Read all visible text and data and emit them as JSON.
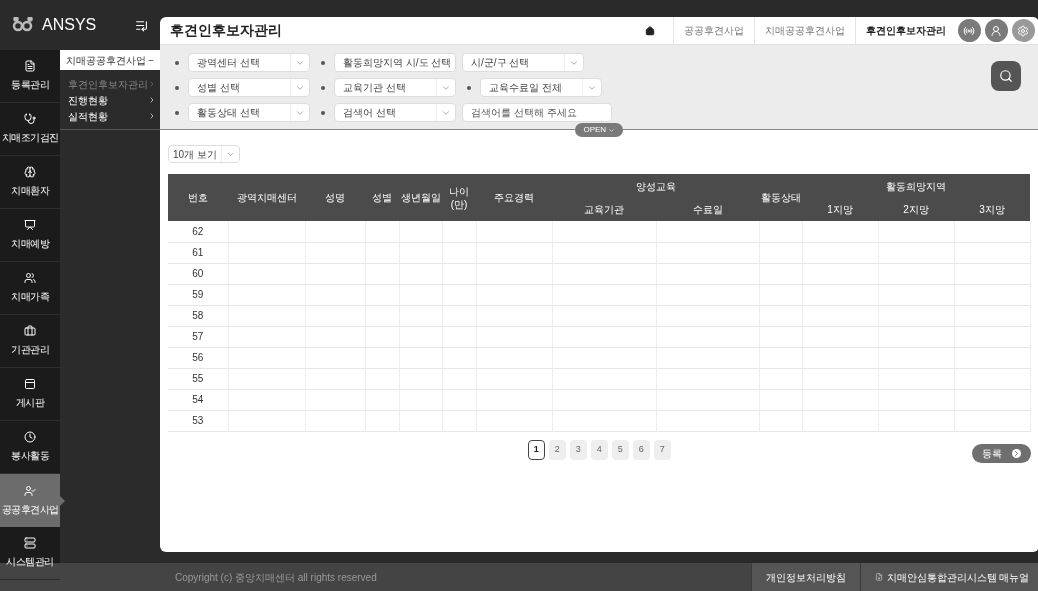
{
  "app": {
    "logo": "ANSYS"
  },
  "rail": [
    {
      "label": "등록관리",
      "selected": false
    },
    {
      "label": "치매조기검진",
      "selected": false
    },
    {
      "label": "치매환자",
      "selected": false
    },
    {
      "label": "치매예방",
      "selected": false
    },
    {
      "label": "치매가족",
      "selected": false
    },
    {
      "label": "기관관리",
      "selected": false
    },
    {
      "label": "게시판",
      "selected": false
    },
    {
      "label": "봉사활동",
      "selected": false
    },
    {
      "label": "공공후견사업",
      "selected": true
    },
    {
      "label": "시스템관리",
      "selected": false
    }
  ],
  "submenu": {
    "title": "치매공공후견사업",
    "toggle": "−",
    "items": [
      {
        "label": "후견인후보자관리",
        "selected": true
      },
      {
        "label": "진행현황",
        "selected": false
      },
      {
        "label": "실적현황",
        "selected": false
      }
    ]
  },
  "page": {
    "title": "후견인후보자관리",
    "breadcrumb": [
      {
        "label": "공공후견사업",
        "selected": false
      },
      {
        "label": "치매공공후견사업",
        "selected": false
      },
      {
        "label": "후견인후보자관리",
        "selected": true
      }
    ]
  },
  "filters": [
    [
      {
        "kind": "select",
        "label": "광역센터 선택",
        "bullet": true
      },
      {
        "kind": "select",
        "label": "활동희망지역 시/도 선택",
        "bullet": true
      },
      {
        "kind": "select",
        "label": "시/군/구 선택",
        "bullet": false
      }
    ],
    [
      {
        "kind": "select",
        "label": "성별 선택",
        "bullet": true
      },
      {
        "kind": "select",
        "label": "교육기관 선택",
        "bullet": true
      },
      {
        "kind": "select",
        "label": "교육수료일 전체",
        "bullet": true
      }
    ],
    [
      {
        "kind": "select",
        "label": "활동상태 선택",
        "bullet": true
      },
      {
        "kind": "select",
        "label": "검색어 선택",
        "bullet": true
      },
      {
        "kind": "input",
        "placeholder": "검색어를 선택해 주세요"
      }
    ]
  ],
  "filter_toggle": "OPEN",
  "page_size": "10개 보기",
  "table": {
    "columns": [
      {
        "label": "번호"
      },
      {
        "label": "광역치매센터"
      },
      {
        "label": "성명"
      },
      {
        "label": "성별"
      },
      {
        "label": "생년월일"
      },
      {
        "label": "나이\n(만)"
      },
      {
        "label": "주요경력"
      },
      {
        "label": "양성교육",
        "children": [
          {
            "label": "교육기관"
          },
          {
            "label": "수료일"
          }
        ]
      },
      {
        "label": "활동상태"
      },
      {
        "label": "활동희망지역",
        "children": [
          {
            "label": "1지망"
          },
          {
            "label": "2지망"
          },
          {
            "label": "3지망"
          }
        ]
      }
    ],
    "rows": [
      {
        "number": "62"
      },
      {
        "number": "61"
      },
      {
        "number": "60"
      },
      {
        "number": "59"
      },
      {
        "number": "58"
      },
      {
        "number": "57"
      },
      {
        "number": "56"
      },
      {
        "number": "55"
      },
      {
        "number": "54"
      },
      {
        "number": "53"
      }
    ]
  },
  "pagination": [
    {
      "label": "1",
      "selected": true
    },
    {
      "label": "2",
      "selected": false
    },
    {
      "label": "3",
      "selected": false
    },
    {
      "label": "4",
      "selected": false
    },
    {
      "label": "5",
      "selected": false
    },
    {
      "label": "6",
      "selected": false
    },
    {
      "label": "7",
      "selected": false
    }
  ],
  "register_button": "등록",
  "footer": {
    "copyright": "Copyright (c) 중앙치매센터 all rights reserved",
    "links": [
      "개인정보처리방침",
      "치매안심통합관리시스템 매뉴얼"
    ]
  }
}
